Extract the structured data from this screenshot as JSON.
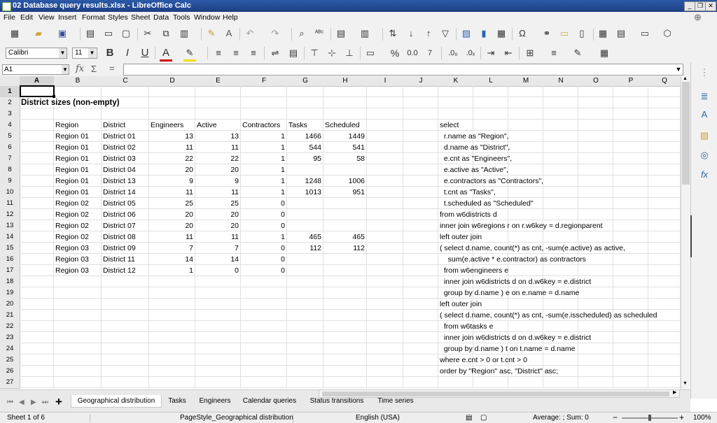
{
  "window": {
    "title": "02 Database query results.xlsx - LibreOffice Calc"
  },
  "menu": [
    "File",
    "Edit",
    "View",
    "Insert",
    "Format",
    "Styles",
    "Sheet",
    "Data",
    "Tools",
    "Window",
    "Help"
  ],
  "toolbar": {
    "font_name": "Calibri",
    "font_size": "11"
  },
  "formula": {
    "cell_ref": "A1",
    "content": ""
  },
  "columns": [
    "A",
    "B",
    "C",
    "D",
    "E",
    "F",
    "G",
    "H",
    "I",
    "J",
    "K",
    "L",
    "M",
    "N",
    "O",
    "P",
    "Q"
  ],
  "rows": [
    "1",
    "2",
    "3",
    "4",
    "5",
    "6",
    "7",
    "8",
    "9",
    "10",
    "11",
    "12",
    "13",
    "14",
    "15",
    "16",
    "17",
    "18",
    "19",
    "20",
    "21",
    "22",
    "23",
    "24",
    "25",
    "26",
    "27"
  ],
  "sheet": {
    "title": "District sizes (non-empty)",
    "headers": [
      "Region",
      "District",
      "Engineers",
      "Active",
      "Contractors",
      "Tasks",
      "Scheduled"
    ],
    "data": [
      [
        "Region 01",
        "District 01",
        "13",
        "13",
        "1",
        "1466",
        "1449"
      ],
      [
        "Region 01",
        "District 02",
        "11",
        "11",
        "1",
        "544",
        "541"
      ],
      [
        "Region 01",
        "District 03",
        "22",
        "22",
        "1",
        "95",
        "58"
      ],
      [
        "Region 01",
        "District 04",
        "20",
        "20",
        "1",
        "",
        ""
      ],
      [
        "Region 01",
        "District 13",
        "9",
        "9",
        "1",
        "1248",
        "1006"
      ],
      [
        "Region 01",
        "District 14",
        "11",
        "11",
        "1",
        "1013",
        "951"
      ],
      [
        "Region 02",
        "District 05",
        "25",
        "25",
        "0",
        "",
        ""
      ],
      [
        "Region 02",
        "District 06",
        "20",
        "20",
        "0",
        "",
        ""
      ],
      [
        "Region 02",
        "District 07",
        "20",
        "20",
        "0",
        "",
        ""
      ],
      [
        "Region 02",
        "District 08",
        "11",
        "11",
        "1",
        "465",
        "465"
      ],
      [
        "Region 03",
        "District 09",
        "7",
        "7",
        "0",
        "112",
        "112"
      ],
      [
        "Region 03",
        "District 11",
        "14",
        "14",
        "0",
        "",
        ""
      ],
      [
        "Region 03",
        "District 12",
        "1",
        "0",
        "0",
        "",
        ""
      ]
    ],
    "sql": [
      "select",
      "  r.name as \"Region\",",
      "  d.name as \"District\",",
      "  e.cnt as \"Engineers\",",
      "  e.active as \"Active\",",
      "  e.contractors as \"Contractors\",",
      "  t.cnt as \"Tasks\",",
      "  t.scheduled as \"Scheduled\"",
      "from w6districts d",
      "inner join w6regions r on r.w6key = d.regionparent",
      "left outer join",
      "( select d.name, count(*) as cnt, -sum(e.active) as active,",
      "    sum(e.active * e.contractor) as contractors",
      "  from w6engineers e",
      "  inner join w6districts d on d.w6key = e.district",
      "  group by d.name ) e on e.name = d.name",
      "left outer join",
      "( select d.name, count(*) as cnt, -sum(e.isscheduled) as scheduled",
      "  from w6tasks e",
      "  inner join w6districts d on d.w6key = e.district",
      "  group by d.name ) t on t.name = d.name",
      "where e.cnt > 0 or t.cnt > 0",
      "order by \"Region\" asc, \"District\" asc;"
    ]
  },
  "tabs": [
    "Geographical distribution",
    "Tasks",
    "Engineers",
    "Calendar queries",
    "Status transitions",
    "Time series"
  ],
  "active_tab": "Geographical distribution",
  "status": {
    "sheet": "Sheet 1 of 6",
    "page_style": "PageStyle_Geographical distribution",
    "language": "English (USA)",
    "summary": "Average: ; Sum: 0",
    "zoom": "100%"
  },
  "icons": [
    "new-icon",
    "open-icon",
    "save-icon",
    "pdf-icon",
    "print-icon",
    "print-preview-icon",
    "cut-icon",
    "copy-icon",
    "paste-icon",
    "clone-formatting-icon",
    "clear-formatting-icon",
    "undo-icon",
    "redo-icon",
    "find-replace-icon",
    "spellcheck-icon",
    "row-icon",
    "column-icon",
    "sort-icon",
    "sort-ascending-icon",
    "sort-descending-icon",
    "autofilter-icon",
    "image-icon",
    "chart-icon",
    "pivot-icon",
    "special-character-icon",
    "hyperlink-icon",
    "comment-icon",
    "header-footer-icon",
    "define-print-area-icon",
    "freeze-icon",
    "split-window-icon",
    "show-draw-functions-icon"
  ],
  "colors": {
    "title_bar": "#1f4a96",
    "selection": "#000000",
    "squiggle": "#dd2222"
  }
}
